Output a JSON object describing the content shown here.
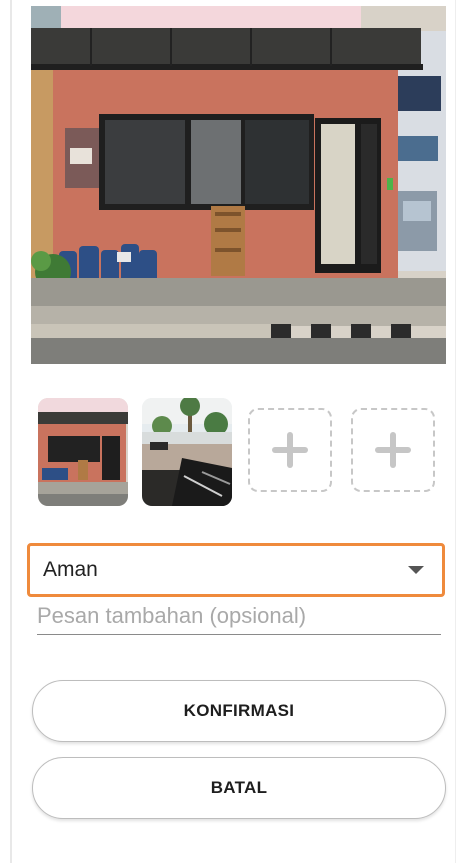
{
  "photos": {
    "main": {
      "alt": ""
    },
    "thumbnails": [
      {
        "kind": "photo"
      },
      {
        "kind": "photo"
      }
    ],
    "add_slots": 2
  },
  "status_select": {
    "value": "Aman",
    "options": [
      "Aman"
    ]
  },
  "message": {
    "value": "",
    "placeholder": "Pesan tambahan (opsional)"
  },
  "buttons": {
    "confirm_label": "KONFIRMASI",
    "cancel_label": "BATAL"
  },
  "colors": {
    "accent_border": "#ef8a3c",
    "dashed_border": "#c7c7c7",
    "plus_icon": "#c6c6c6"
  },
  "icons": {
    "dropdown": "caret-down-icon",
    "add_photo": "plus-icon"
  }
}
